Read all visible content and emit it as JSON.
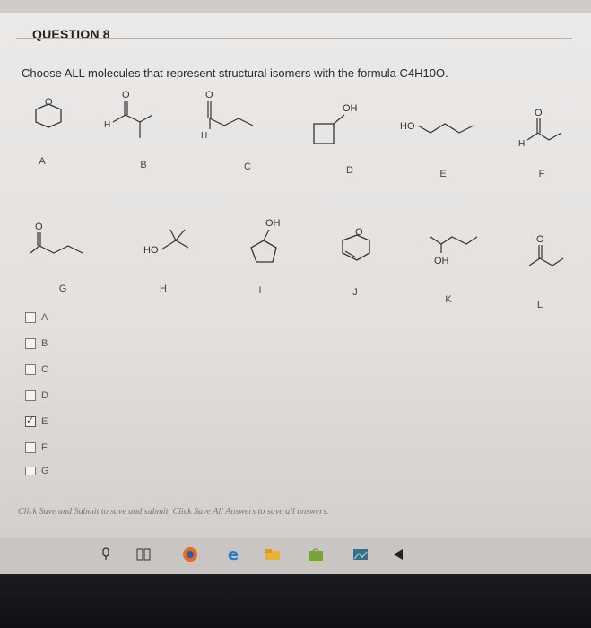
{
  "question": {
    "title": "QUESTION 8",
    "prompt": "Choose ALL molecules that represent structural isomers with the formula C4H10O."
  },
  "molecules": {
    "A": {
      "label": "A"
    },
    "B": {
      "label": "B",
      "atom1": "O",
      "atom2": "H"
    },
    "C": {
      "label": "C",
      "atom1": "O",
      "atom2": "H"
    },
    "D": {
      "label": "D",
      "atom1": "OH"
    },
    "E": {
      "label": "E",
      "atom1": "HO"
    },
    "F": {
      "label": "F",
      "atom1": "O",
      "atom2": "H"
    },
    "G": {
      "label": "G",
      "atom1": "O"
    },
    "H": {
      "label": "H",
      "atom1": "HO"
    },
    "I": {
      "label": "I",
      "atom1": "OH"
    },
    "J": {
      "label": "J",
      "atom1": "O"
    },
    "K": {
      "label": "K",
      "atom1": "OH"
    },
    "L": {
      "label": "L",
      "atom1": "O"
    },
    "A_atom": "O"
  },
  "choices": [
    {
      "label": "A",
      "checked": false
    },
    {
      "label": "B",
      "checked": false
    },
    {
      "label": "C",
      "checked": false
    },
    {
      "label": "D",
      "checked": false
    },
    {
      "label": "E",
      "checked": true
    },
    {
      "label": "F",
      "checked": false
    },
    {
      "label": "G",
      "checked": false
    }
  ],
  "footer": "Click Save and Submit to save and submit. Click Save All Answers to save all answers.",
  "taskbar": {
    "icons": [
      "microphone-icon",
      "task-view-icon",
      "firefox-icon",
      "edge-icon",
      "file-explorer-icon",
      "store-icon",
      "photos-icon",
      "media-icon"
    ]
  },
  "colors": {
    "firefox": "#e76b1c",
    "edge": "#1e7fd6",
    "explorer": "#e9b33a",
    "store": "#7aa33b"
  }
}
